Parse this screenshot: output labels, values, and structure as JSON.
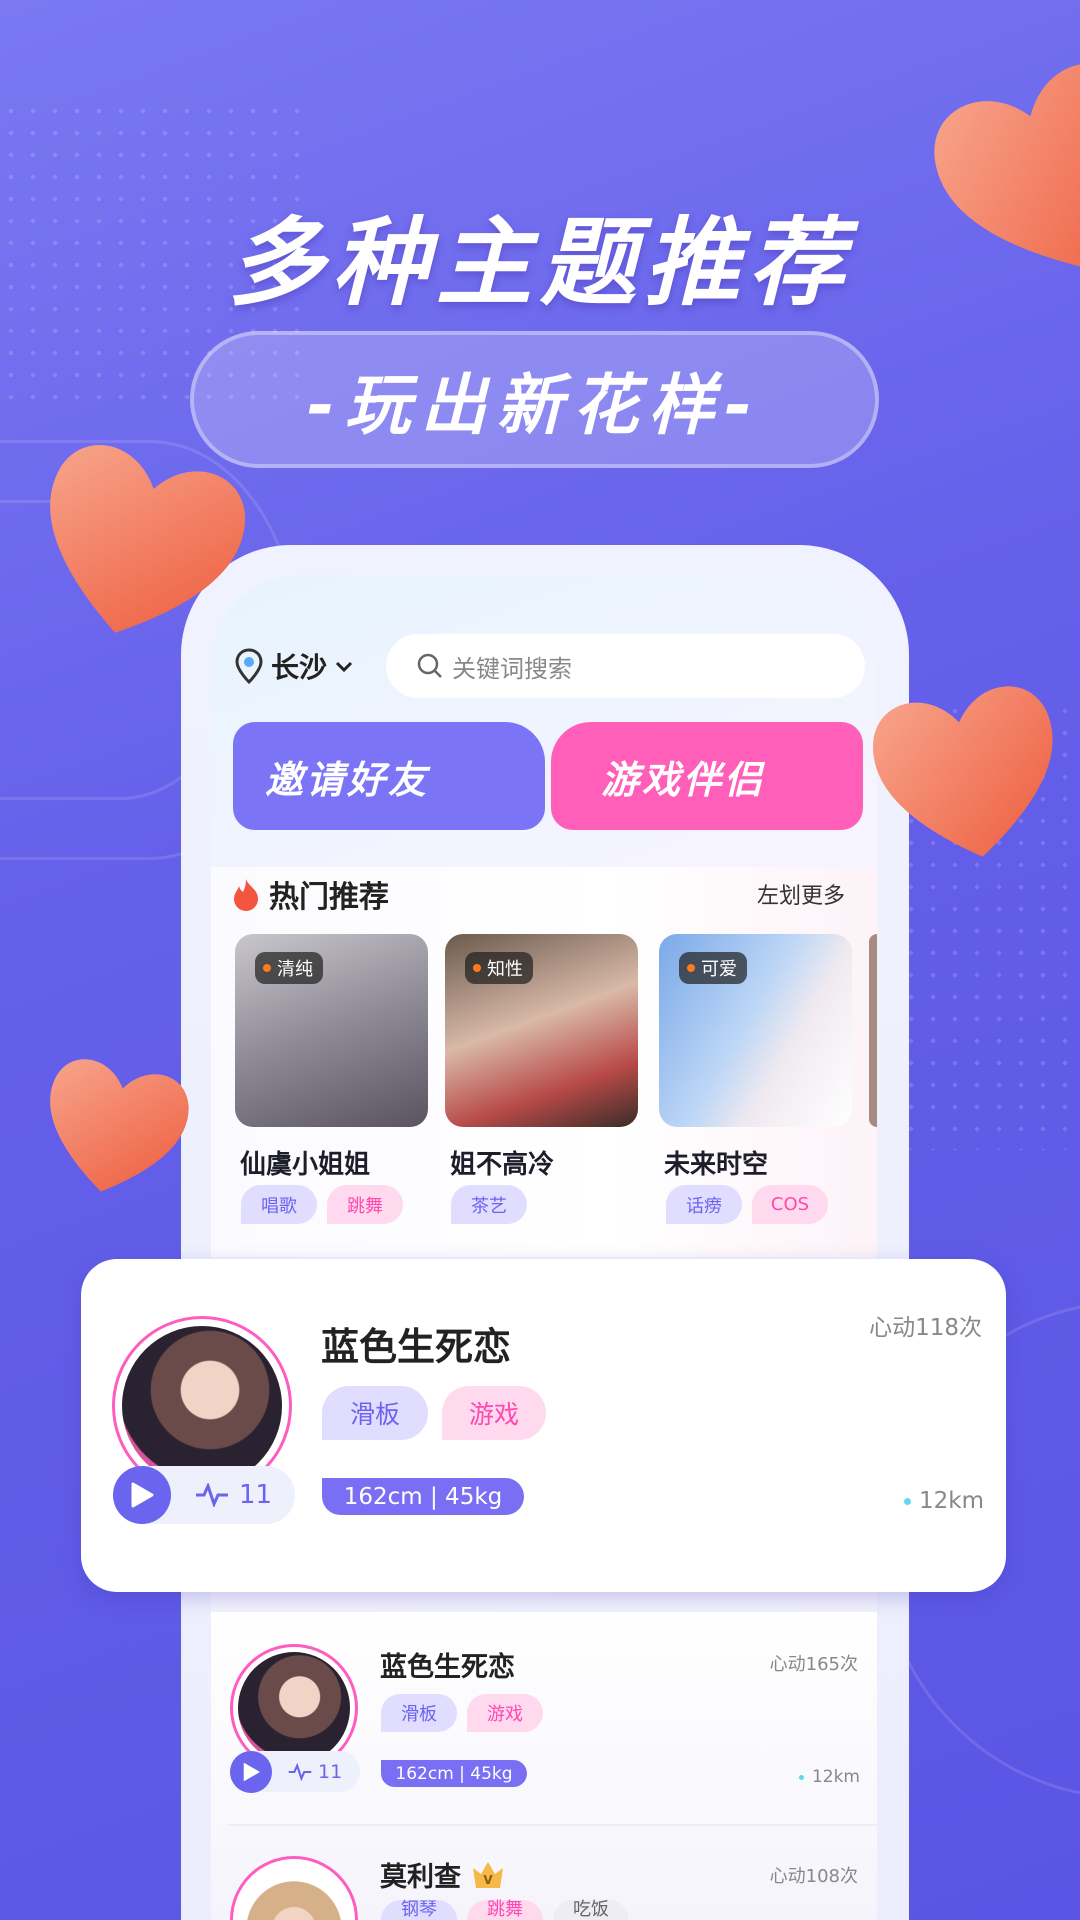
{
  "banner": {
    "headline": "多种主题推荐",
    "subline": "-玩出新花样-"
  },
  "colors": {
    "background": "#6560ea",
    "accent_purple": "#7a6ff4",
    "accent_pink": "#ff5fb8",
    "heart": "#f4704f"
  },
  "app": {
    "location": {
      "city": "长沙",
      "icon": "location-pin-icon"
    },
    "search": {
      "placeholder": "关键词搜索",
      "icon": "search-icon"
    },
    "buttons": [
      {
        "label": "邀请好友"
      },
      {
        "label": "游戏伴侣"
      }
    ],
    "hot": {
      "title": "热门推荐",
      "icon": "flame-icon",
      "more": "左划更多",
      "cards": [
        {
          "badge": "清纯",
          "name": "仙虞小姐姐",
          "tags": [
            "唱歌",
            "跳舞"
          ]
        },
        {
          "badge": "知性",
          "name": "姐不高冷",
          "tags": [
            "茶艺"
          ]
        },
        {
          "badge": "可爱",
          "name": "未来时空",
          "tags": [
            "话痨",
            "COS"
          ]
        }
      ]
    },
    "featured": {
      "name": "蓝色生死恋",
      "likes": "心动118次",
      "tags": [
        "滑板",
        "游戏"
      ],
      "stats": "162cm | 45kg",
      "voice_count": "11",
      "distance": "12km"
    },
    "list": [
      {
        "name": "蓝色生死恋",
        "likes": "心动165次",
        "tags": [
          "滑板",
          "游戏"
        ],
        "stats": "162cm | 45kg",
        "voice_count": "11",
        "distance": "12km"
      },
      {
        "name": "莫利查",
        "likes": "心动108次",
        "vip": true,
        "tags": [
          "钢琴",
          "跳舞",
          "吃饭"
        ]
      }
    ]
  }
}
